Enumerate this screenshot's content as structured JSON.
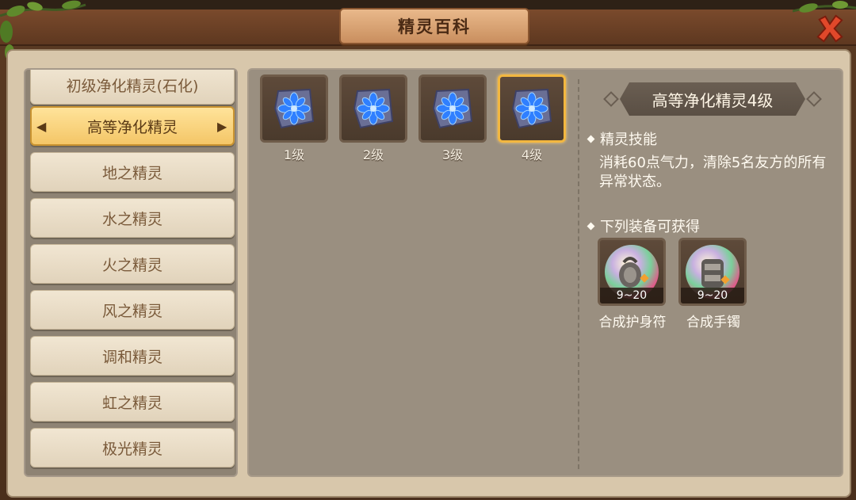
{
  "window": {
    "title": "精灵百科"
  },
  "sidebar": {
    "items": [
      {
        "label": "初级净化精灵(石化)",
        "active": false
      },
      {
        "label": "高等净化精灵",
        "active": true
      },
      {
        "label": "地之精灵",
        "active": false
      },
      {
        "label": "水之精灵",
        "active": false
      },
      {
        "label": "火之精灵",
        "active": false
      },
      {
        "label": "风之精灵",
        "active": false
      },
      {
        "label": "调和精灵",
        "active": false
      },
      {
        "label": "虹之精灵",
        "active": false
      },
      {
        "label": "极光精灵",
        "active": false
      }
    ]
  },
  "levels": [
    {
      "label": "1级",
      "icon": "blue-flower-stone-icon",
      "selected": false
    },
    {
      "label": "2级",
      "icon": "blue-flower-stone-icon",
      "selected": false
    },
    {
      "label": "3级",
      "icon": "blue-flower-stone-icon",
      "selected": false
    },
    {
      "label": "4级",
      "icon": "blue-flower-stone-icon",
      "selected": true
    }
  ],
  "detail": {
    "title": "高等净化精灵4级",
    "skill_heading": "精灵技能",
    "skill_description": "消耗60点气力，清除5名友方的所有异常状态。",
    "equipment_heading": "下列装备可获得",
    "equipment": [
      {
        "name": "合成护身符",
        "range": "9~20",
        "icon": "amulet-bubble-icon"
      },
      {
        "name": "合成手镯",
        "range": "9~20",
        "icon": "bracelet-bubble-icon"
      }
    ]
  },
  "colors": {
    "active_tab": "#f4c667",
    "selected_border": "#f2b740",
    "close_button": "#e0482a"
  }
}
